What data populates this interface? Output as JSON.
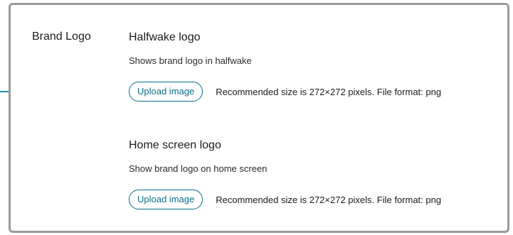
{
  "section": {
    "label": "Brand Logo"
  },
  "settings": [
    {
      "title": "Halfwake logo",
      "description": "Shows brand logo in halfwake",
      "button_label": "Upload image",
      "hint": "Recommended size is 272×272 pixels. File format: png"
    },
    {
      "title": "Home screen logo",
      "description": "Show brand logo on home screen",
      "button_label": "Upload image",
      "hint": "Recommended size is 272×272 pixels. File format: png"
    }
  ],
  "colors": {
    "accent": "#0a6f8a",
    "callout": "#1a8fb0",
    "panel_border": "#9a9a9a"
  }
}
